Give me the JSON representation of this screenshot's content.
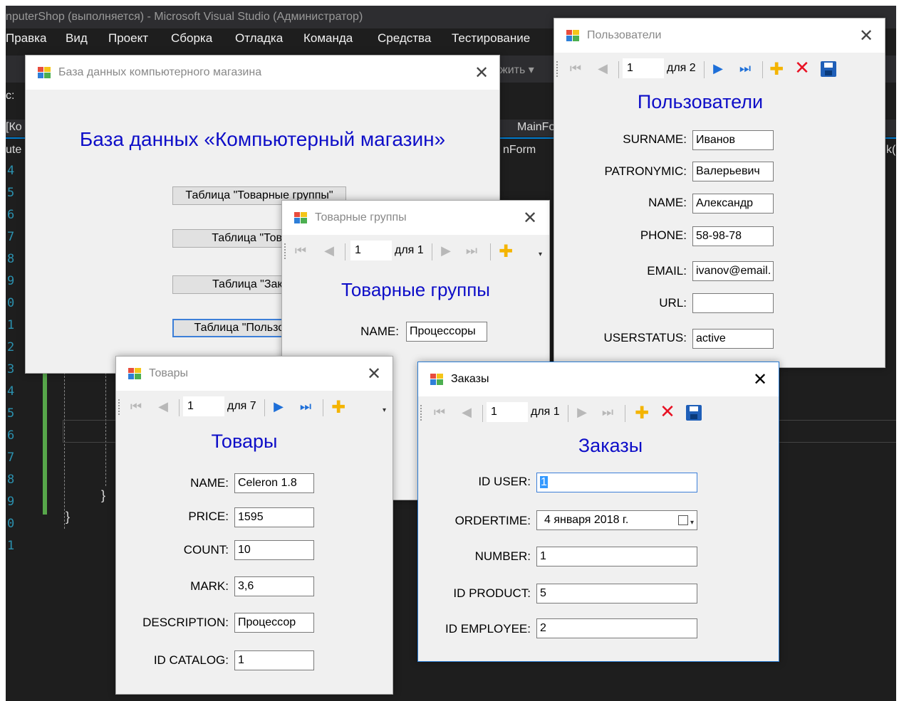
{
  "vs": {
    "title": "nputerShop (выполняется) - Microsoft Visual Studio (Администратор)",
    "menu": [
      "Правка",
      "Вид",
      "Проект",
      "Сборка",
      "Отладка",
      "Команда",
      "Средства",
      "Тестирование"
    ],
    "toolbar_text": "жить ▾",
    "cs_label": "с:",
    "tab_left": "[Ко",
    "tab_mainform": "MainFo",
    "crumb_left": "ute",
    "crumb_mainform": "nForm",
    "crumb_right": "k(с",
    "line_numbers": [
      "4",
      "5",
      "6",
      "7",
      "8",
      "9",
      "0",
      "1",
      "2",
      "3",
      "4",
      "5",
      "6",
      "7",
      "8",
      "9",
      "0",
      "1"
    ],
    "brace_inner": "}",
    "brace_outer": "}"
  },
  "main_window": {
    "title": "База данных компьютерного магазина",
    "heading": "База данных «Компьютерный магазин»",
    "buttons": [
      "Таблица \"Товарные группы\"",
      "Таблица \"Товары\"",
      "Таблица \"Заказы\"",
      "Таблица \"Пользователи\""
    ]
  },
  "groups_window": {
    "title": "Товарные группы",
    "nav": {
      "position": "1",
      "of": "для 1"
    },
    "heading": "Товарные группы",
    "fields": [
      {
        "label": "NAME:",
        "value": "Процессоры"
      }
    ]
  },
  "users_window": {
    "title": "Пользователи",
    "nav": {
      "position": "1",
      "of": "для 2"
    },
    "heading": "Пользователи",
    "fields": [
      {
        "label": "SURNAME:",
        "value": "Иванов"
      },
      {
        "label": "PATRONYMIC:",
        "value": "Валерьевич"
      },
      {
        "label": "NAME:",
        "value": "Александр"
      },
      {
        "label": "PHONE:",
        "value": "58-98-78"
      },
      {
        "label": "EMAIL:",
        "value": "ivanov@email."
      },
      {
        "label": "URL:",
        "value": ""
      },
      {
        "label": "USERSTATUS:",
        "value": "active"
      }
    ]
  },
  "products_window": {
    "title": "Товары",
    "nav": {
      "position": "1",
      "of": "для 7"
    },
    "heading": "Товары",
    "fields": [
      {
        "label": "NAME:",
        "value": "Celeron 1.8"
      },
      {
        "label": "PRICE:",
        "value": "1595"
      },
      {
        "label": "COUNT:",
        "value": "10"
      },
      {
        "label": "MARK:",
        "value": "3,6"
      },
      {
        "label": "DESCRIPTION:",
        "value": "Процессор"
      },
      {
        "label": "ID CATALOG:",
        "value": "1"
      }
    ]
  },
  "orders_window": {
    "title": "Заказы",
    "nav": {
      "position": "1",
      "of": "для 1"
    },
    "heading": "Заказы",
    "fields": [
      {
        "label": "ID USER:",
        "value": "1"
      },
      {
        "label": "ORDERTIME:",
        "value": "4  января  2018 г."
      },
      {
        "label": "NUMBER:",
        "value": "1"
      },
      {
        "label": "ID PRODUCT:",
        "value": "5"
      },
      {
        "label": "ID EMPLOYEE:",
        "value": "2"
      }
    ]
  },
  "icons": {
    "close": "close-icon",
    "app": "winforms-app-icon",
    "first": "move-first-icon",
    "prev": "move-previous-icon",
    "next": "move-next-icon",
    "last": "move-last-icon",
    "add": "add-new-icon",
    "delete": "delete-icon",
    "save": "save-icon"
  },
  "colors": {
    "heading": "#0e0ec8",
    "vs_background": "#1e1e1e",
    "nav_enabled": "#1e6fd8",
    "delete": "#e81123",
    "add": "#f4b400"
  }
}
